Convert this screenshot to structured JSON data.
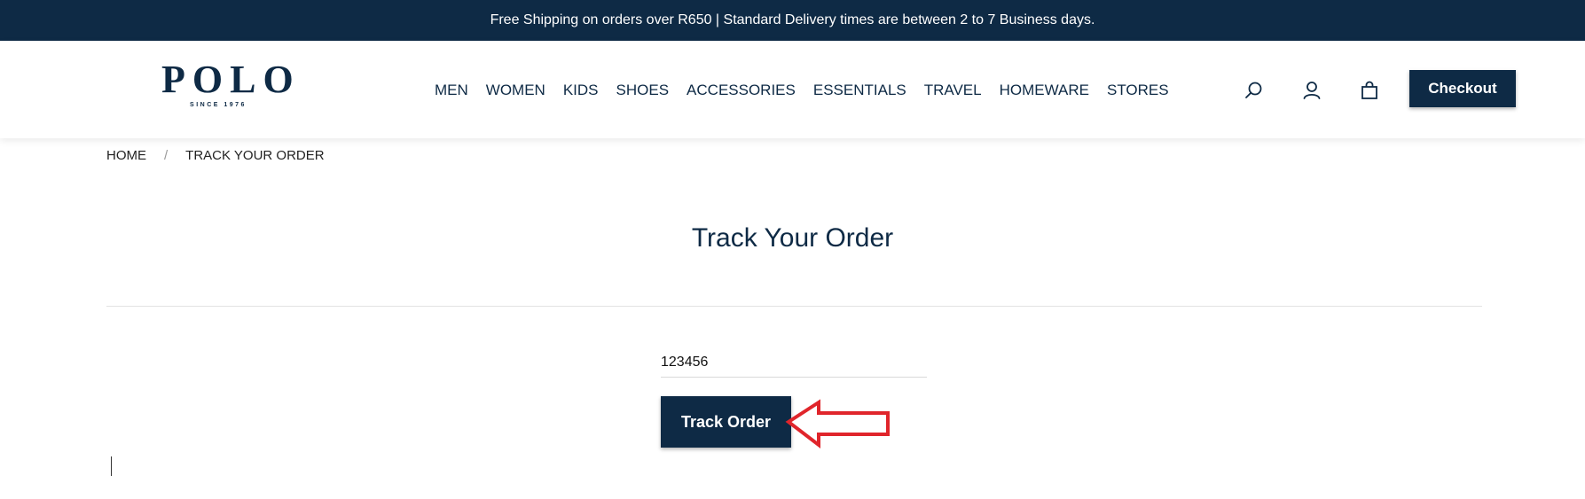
{
  "announcement": "Free Shipping on orders over R650 | Standard Delivery times are between 2 to 7 Business days.",
  "brand": {
    "name": "POLO",
    "tagline": "SINCE 1976"
  },
  "nav": [
    "MEN",
    "WOMEN",
    "KIDS",
    "SHOES",
    "ACCESSORIES",
    "ESSENTIALS",
    "TRAVEL",
    "HOMEWARE",
    "STORES"
  ],
  "header_icons": [
    "search-icon",
    "account-icon",
    "shopping-bag-icon"
  ],
  "checkout_label": "Checkout",
  "breadcrumb": {
    "home": "HOME",
    "separator": "/",
    "current": "TRACK YOUR ORDER"
  },
  "page_title": "Track Your Order",
  "order_input": {
    "value": "123456"
  },
  "track_button_label": "Track Order",
  "colors": {
    "brand_navy": "#0e2a45",
    "annotation_arrow": "#e0252b",
    "white": "#ffffff"
  }
}
